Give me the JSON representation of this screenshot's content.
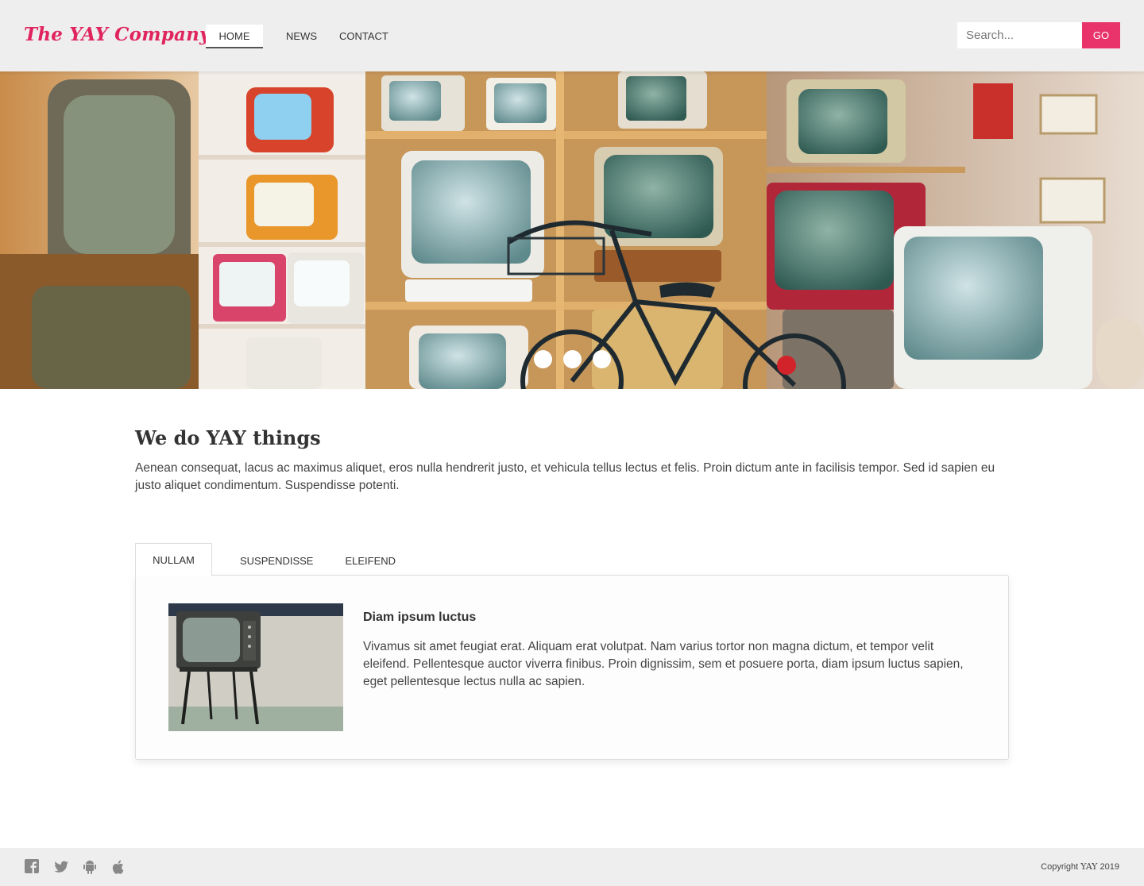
{
  "header": {
    "logo": "The YAY Company",
    "nav": [
      {
        "label": "HOME",
        "active": true
      },
      {
        "label": "NEWS",
        "active": false
      },
      {
        "label": "CONTACT",
        "active": false
      }
    ],
    "search_placeholder": "Search...",
    "go_label": "GO"
  },
  "hero": {
    "slide_count": 3
  },
  "intro": {
    "title": "We do YAY things",
    "text": "Aenean consequat, lacus ac maximus aliquet, eros nulla hendrerit justo, et vehicula tellus lectus et felis. Proin dictum ante in facilisis tempor. Sed id sapien eu justo aliquet condimentum. Suspendisse potenti."
  },
  "tabs": [
    {
      "label": "NULLAM",
      "active": true
    },
    {
      "label": "SUSPENDISSE",
      "active": false
    },
    {
      "label": "ELEIFEND",
      "active": false
    }
  ],
  "card": {
    "title": "Diam ipsum luctus",
    "text": "Vivamus sit amet feugiat erat. Aliquam erat volutpat. Nam varius tortor non magna dictum, et tempor velit eleifend. Pellentesque auctor viverra finibus. Proin dignissim, sem et posuere porta, diam ipsum luctus sapien, eget pellentesque lectus nulla ac sapien."
  },
  "footer": {
    "icons": [
      "facebook-icon",
      "twitter-icon",
      "android-icon",
      "apple-icon"
    ],
    "copyright_prefix": "Copyright",
    "copyright_brand": "YAY",
    "copyright_year": "2019"
  },
  "colors": {
    "accent": "#e0245e",
    "header_bg": "#eeeeee",
    "footer_bg": "#eeeeee"
  }
}
